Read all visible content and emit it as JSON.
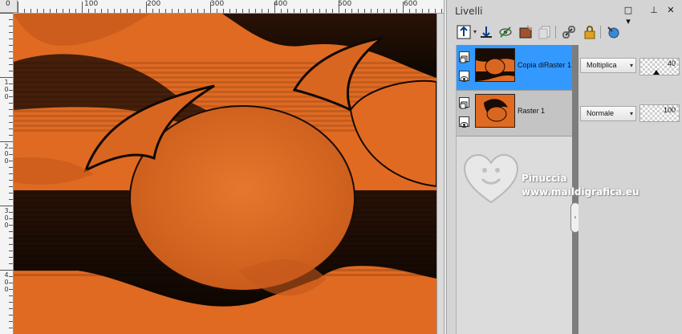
{
  "rulers": {
    "top_labels": [
      "0",
      "100",
      "200",
      "300",
      "400",
      "500",
      "600"
    ],
    "left_labels": [
      [
        "1",
        "0",
        "0"
      ],
      [
        "2",
        "0",
        "0"
      ],
      [
        "3",
        "0",
        "0"
      ],
      [
        "4",
        "0",
        "0"
      ]
    ]
  },
  "panel": {
    "title": "Livelli",
    "title_buttons": {
      "dropdown": "□ ▾",
      "pin": "⊥",
      "close": "✕"
    },
    "toolbar_icons": [
      "new-raster-layer-icon",
      "new-vector-layer-icon",
      "new-mask-icon",
      "new-adjustment-layer-icon",
      "duplicate-layer-icon",
      "link-layers-icon",
      "lock-layer-icon",
      "delete-layer-icon"
    ]
  },
  "layers": [
    {
      "name": "Copia diRaster 1",
      "blend_mode": "Moltiplica",
      "opacity": "40",
      "selected": true
    },
    {
      "name": "Raster 1",
      "blend_mode": "Normale",
      "opacity": "100",
      "selected": false
    }
  ],
  "watermark": {
    "name": "Pinuccia",
    "url": "www.maildigrafica.eu"
  },
  "colors": {
    "selection": "#3399ff",
    "artwork_orange": "#e06a22",
    "artwork_dark": "#1a0c04"
  }
}
